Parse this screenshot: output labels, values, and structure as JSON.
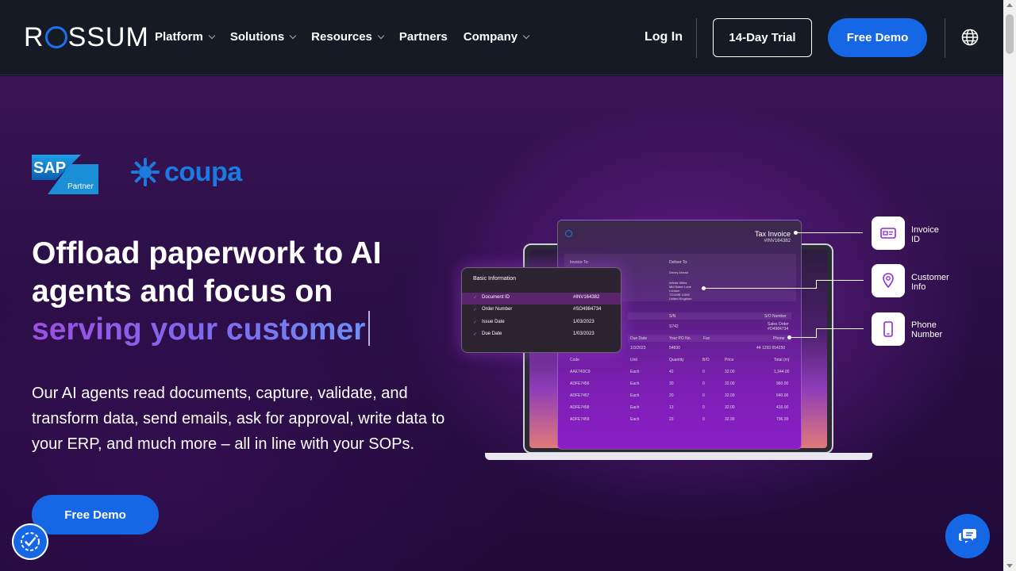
{
  "header": {
    "logo_prefix": "R",
    "logo_suffix": "SSUM",
    "nav": [
      {
        "label": "Platform",
        "has_dropdown": true
      },
      {
        "label": "Solutions",
        "has_dropdown": true
      },
      {
        "label": "Resources",
        "has_dropdown": true
      },
      {
        "label": "Partners",
        "has_dropdown": false
      },
      {
        "label": "Company",
        "has_dropdown": true
      }
    ],
    "login_label": "Log In",
    "trial_label": "14-Day Trial",
    "demo_label": "Free Demo",
    "language_icon": "globe-icon"
  },
  "hero": {
    "sap_text": "SAP",
    "sap_partner": "Partner",
    "coupa_text": "coupa",
    "headline_line1": "Offload paperwork to AI",
    "headline_line2": "agents and focus on",
    "headline_highlight": "serving your customer",
    "subtext": "Our AI agents read documents, capture, validate, and transform data, send emails, ask for approval, write data to your ERP, and much more – all in line with your SOPs.",
    "cta_label": "Free Demo"
  },
  "mockup": {
    "invoice_title": "Tax Invoice",
    "invoice_number": "#INV164382",
    "invoice_to": "Invoice To:",
    "deliver_to": "Deliver To:",
    "deliver_name": "Drivey Ahead",
    "deliver_address": [
      "Infinite Miles",
      "Mid Baker Lane",
      "London",
      "TZ109B 100W",
      "United Kingdom"
    ],
    "sn_label": "S/N",
    "sn_value": "S742",
    "so_label": "S/O Number",
    "so_value_label": "Sales Order",
    "so_value": "#O4984734",
    "due_label": "Due Date",
    "due_value": "1/3/2023",
    "po_label": "Your PO No.",
    "po_value": "54830",
    "fax_label": "Fax",
    "phone_label": "Phone",
    "phone_value": "44 1293 654250",
    "table_headers": [
      "Code",
      "Unit",
      "Quantity",
      "B/O",
      "Price",
      "Total (m)"
    ],
    "table_rows": [
      [
        "AAE74DC9",
        "Each",
        "42",
        "0",
        "32.00",
        "1,344.00"
      ],
      [
        "ADFE7456",
        "Each",
        "30",
        "0",
        "32.00",
        "960.00"
      ],
      [
        "ADFE7457",
        "Each",
        "20",
        "0",
        "32.00",
        "640.00"
      ],
      [
        "ADFE7458",
        "Each",
        "13",
        "0",
        "32.00",
        "416.00"
      ],
      [
        "ADFE7459",
        "Each",
        "23",
        "0",
        "32.00",
        "736.00"
      ]
    ],
    "basic_info": {
      "title": "Basic Information",
      "rows": [
        {
          "label": "Document ID",
          "value": "#INV164382"
        },
        {
          "label": "Order Number",
          "value": "#SO4984734"
        },
        {
          "label": "Issue Date",
          "value": "1/03/2023"
        },
        {
          "label": "Due Date",
          "value": "1/03/2023"
        }
      ]
    },
    "chips": [
      {
        "line1": "Invoice",
        "line2": "ID",
        "icon": "id-card-icon"
      },
      {
        "line1": "Customer",
        "line2": "Info",
        "icon": "location-pin-icon"
      },
      {
        "line1": "Phone",
        "line2": "Number",
        "icon": "phone-icon"
      }
    ]
  },
  "floating": {
    "accessibility_icon": "accessibility-check-icon",
    "chat_icon": "chat-bubbles-icon"
  },
  "colors": {
    "header_bg": "#161a24",
    "accent_blue": "#1667e6",
    "hero_purple": "#2a0f45",
    "highlight_gradient_start": "#9b4fe0",
    "highlight_gradient_end": "#6f8ef5"
  }
}
